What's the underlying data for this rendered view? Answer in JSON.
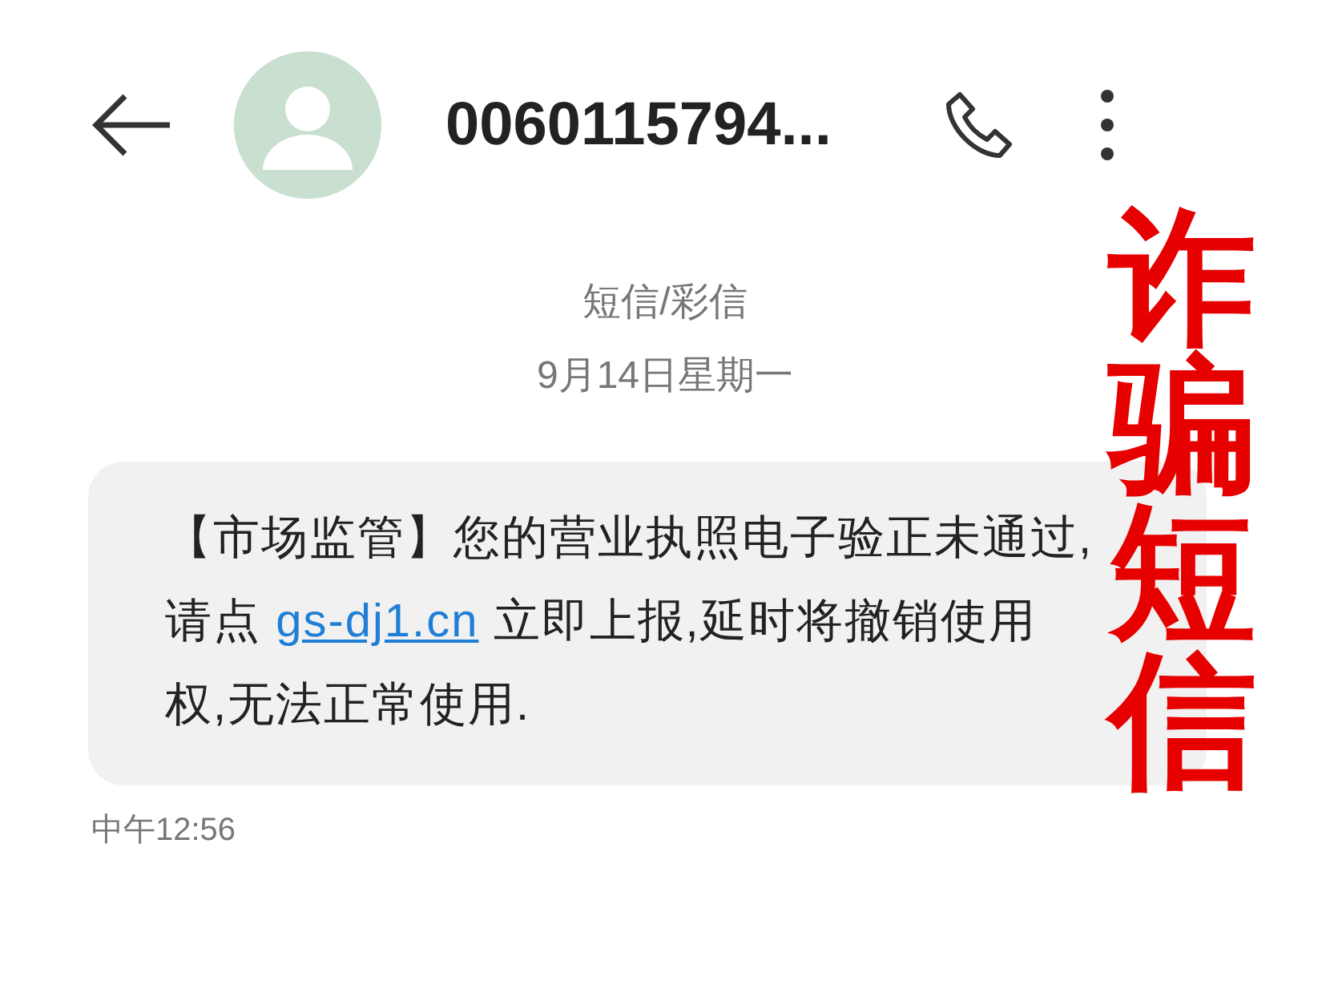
{
  "header": {
    "contact": "0060115794..."
  },
  "thread": {
    "channel": "短信/彩信",
    "date": "9月14日星期一"
  },
  "messages": [
    {
      "text": "【市场监管】您的营业执照电子验正未通过,请点 ",
      "link": "gs-dj1.cn",
      "text_after": " 立即上报,延时将撤销使用权,无法正常使用.",
      "time": "中午12:56"
    }
  ],
  "annotation": {
    "text": "诈骗短信"
  }
}
